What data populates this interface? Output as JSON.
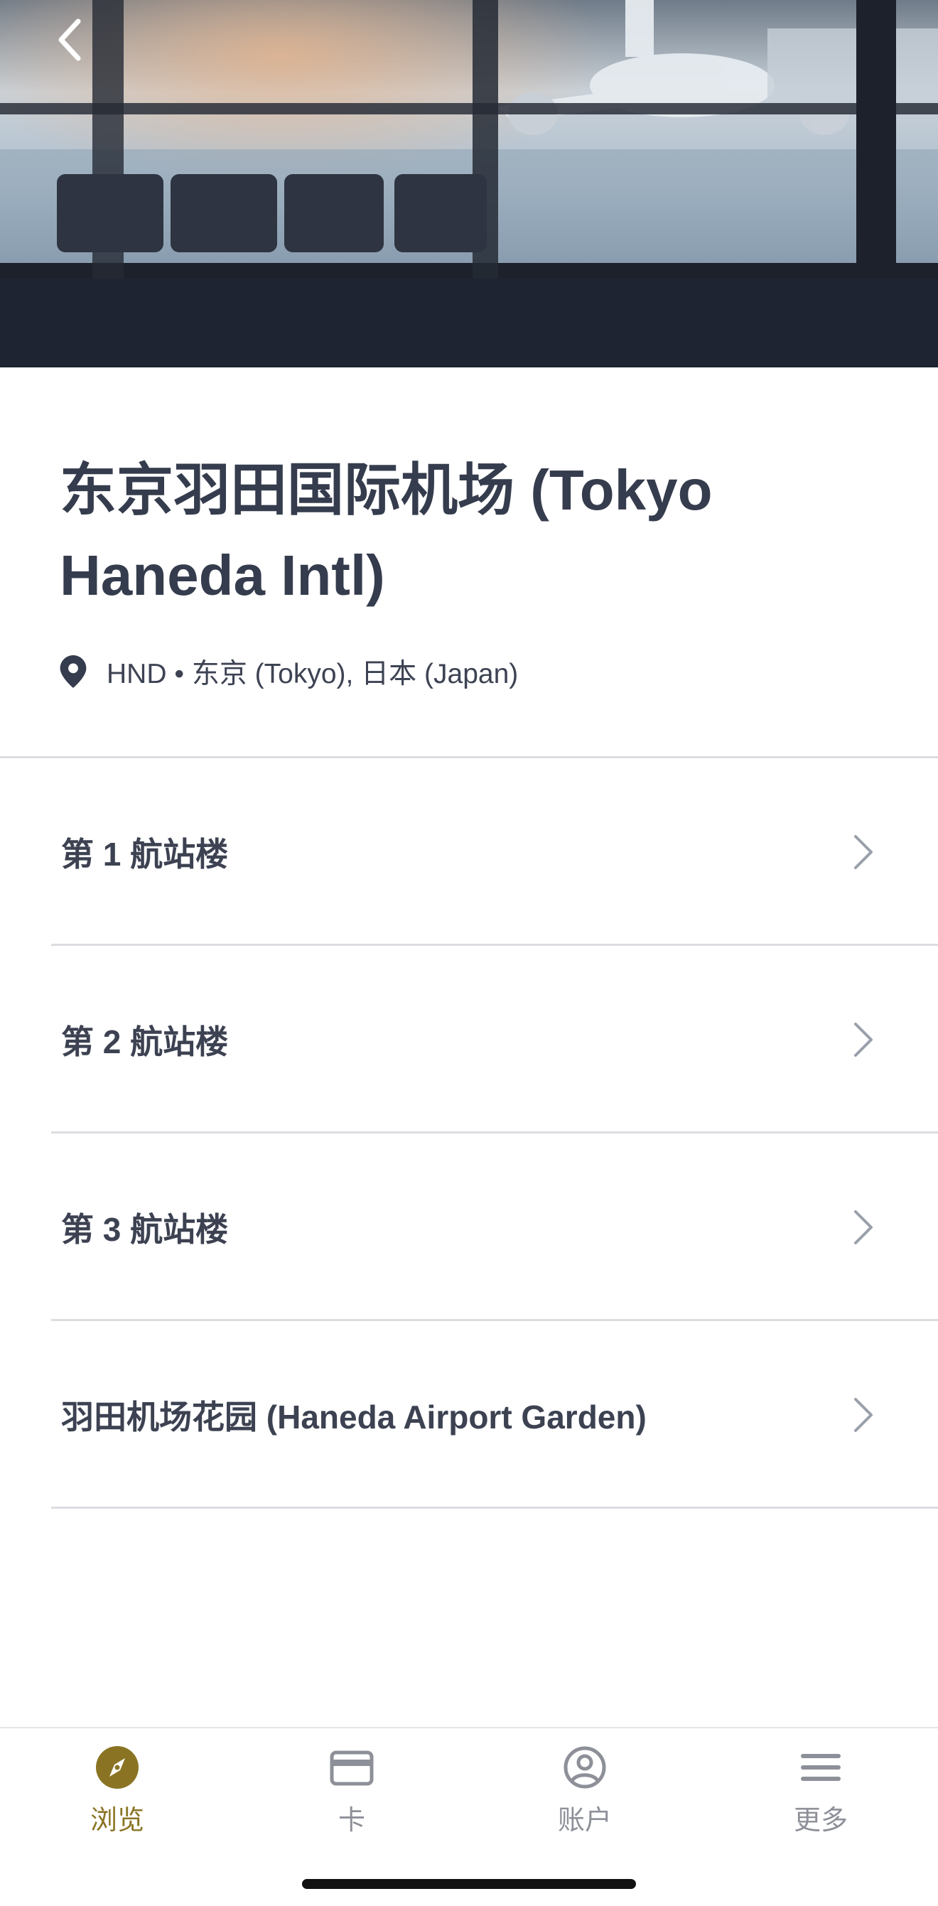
{
  "airport": {
    "title": "东京羽田国际机场 (Tokyo Haneda Intl)",
    "location": "HND • 东京 (Tokyo), 日本 (Japan)"
  },
  "terminals": [
    {
      "label": "第 1 航站楼"
    },
    {
      "label": "第 2 航站楼"
    },
    {
      "label": "第 3 航站楼"
    },
    {
      "label": "羽田机场花园 (Haneda Airport Garden)"
    }
  ],
  "tabs": [
    {
      "label": "浏览",
      "icon": "compass-icon",
      "active": true
    },
    {
      "label": "卡",
      "icon": "card-icon",
      "active": false
    },
    {
      "label": "账户",
      "icon": "account-icon",
      "active": false
    },
    {
      "label": "更多",
      "icon": "menu-icon",
      "active": false
    }
  ],
  "colors": {
    "accent": "#8a7424",
    "text_primary": "#353c4d",
    "tab_inactive": "#8d9098",
    "divider": "#dcdde1"
  }
}
